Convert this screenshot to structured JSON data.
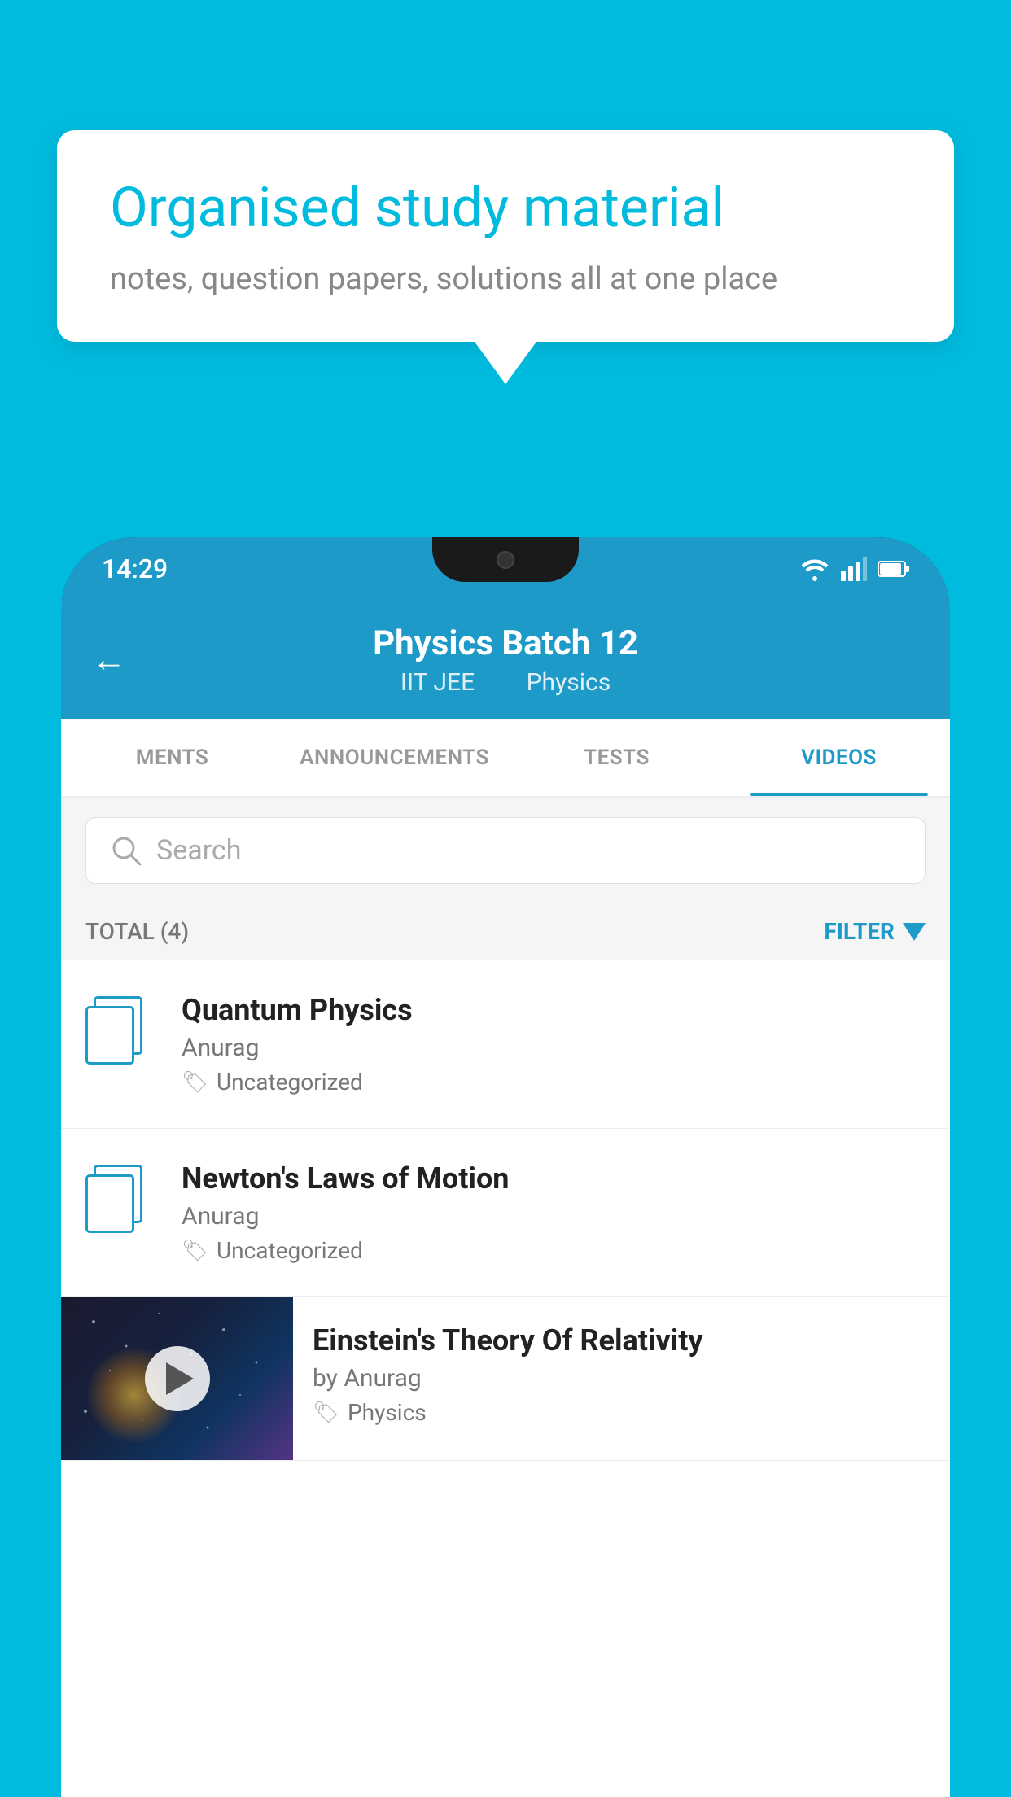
{
  "background_color": "#00BBDE",
  "bubble": {
    "title": "Organised study material",
    "subtitle": "notes, question papers, solutions all at one place"
  },
  "status_bar": {
    "time": "14:29",
    "icons": [
      "wifi",
      "signal",
      "battery"
    ]
  },
  "app_header": {
    "back_label": "←",
    "title": "Physics Batch 12",
    "subtitle_tag1": "IIT JEE",
    "subtitle_tag2": "Physics"
  },
  "tabs": [
    {
      "label": "MENTS",
      "active": false
    },
    {
      "label": "ANNOUNCEMENTS",
      "active": false
    },
    {
      "label": "TESTS",
      "active": false
    },
    {
      "label": "VIDEOS",
      "active": true
    }
  ],
  "search": {
    "placeholder": "Search"
  },
  "filter_row": {
    "total_label": "TOTAL (4)",
    "filter_label": "FILTER"
  },
  "videos": [
    {
      "title": "Quantum Physics",
      "author": "Anurag",
      "tag": "Uncategorized",
      "type": "file"
    },
    {
      "title": "Newton's Laws of Motion",
      "author": "Anurag",
      "tag": "Uncategorized",
      "type": "file"
    },
    {
      "title": "Einstein's Theory Of Relativity",
      "author": "by Anurag",
      "tag": "Physics",
      "type": "video"
    }
  ]
}
